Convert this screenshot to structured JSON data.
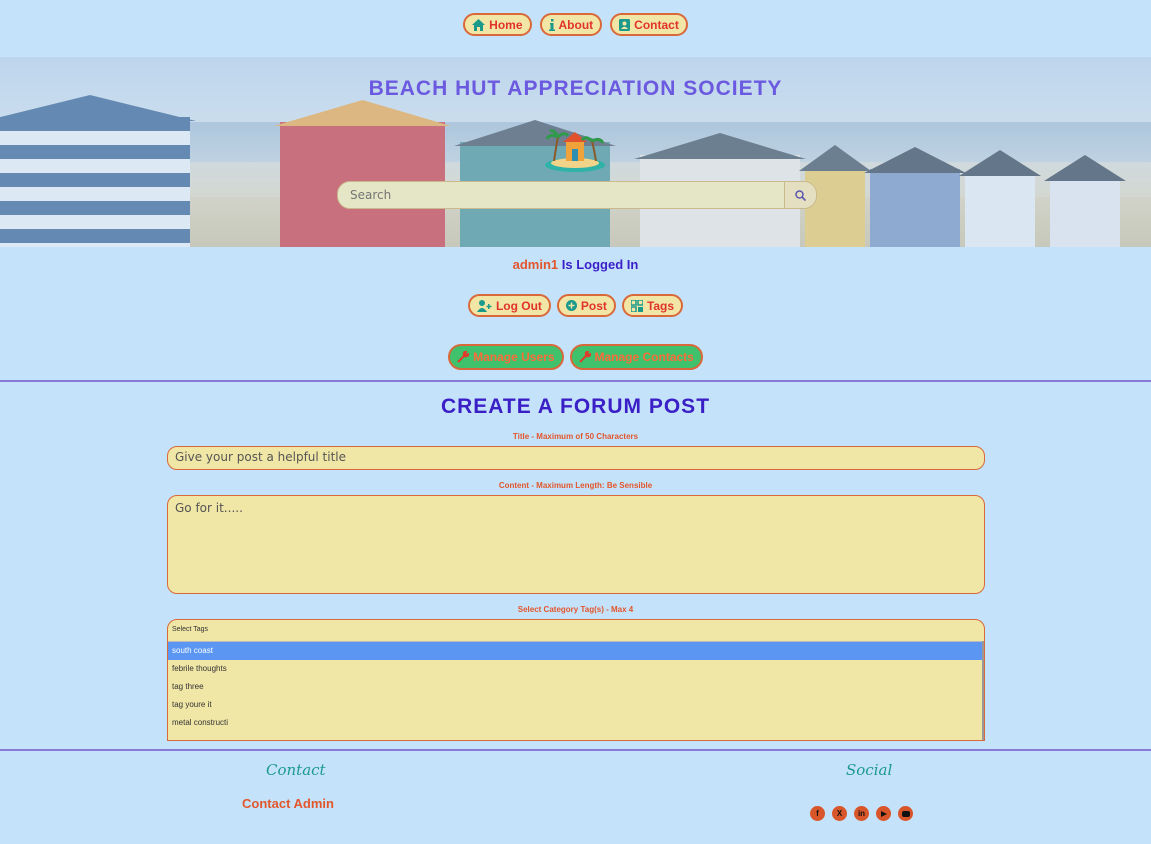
{
  "nav": {
    "home": "Home",
    "about": "About",
    "contact": "Contact"
  },
  "hero": {
    "title": "BEACH HUT APPRECIATION SOCIETY",
    "search_placeholder": "Search"
  },
  "session": {
    "username": "admin1",
    "status": "Is Logged In"
  },
  "actions": {
    "logout": "Log Out",
    "post": "Post",
    "tags": "Tags",
    "manage_users": "Manage Users",
    "manage_contacts": "Manage Contacts"
  },
  "form": {
    "heading": "CREATE A FORUM POST",
    "title_label": "Title - Maximum of 50 Characters",
    "title_placeholder": "Give your post a helpful title",
    "content_label": "Content - Maximum Length: Be Sensible",
    "content_placeholder": "Go for it.....",
    "tags_label": "Select Category Tag(s) - Max 4",
    "tags_placeholder": "Select Tags",
    "tag_options": [
      "south coast",
      "febrile thoughts",
      "tag three",
      "tag youre it",
      "metal constructi"
    ],
    "selected_tag": "south coast"
  },
  "footer": {
    "contact_heading": "Contact",
    "contact_link": "Contact Admin",
    "social_heading": "Social",
    "social_icons": [
      "facebook-icon",
      "x-icon",
      "linkedin-icon",
      "youtube-icon",
      "discord-icon"
    ]
  },
  "colors": {
    "background": "#c5e2fb",
    "accent_orange": "#e2562b",
    "accent_purple": "#3a1fc7",
    "pill_bg": "#f2e6a6",
    "manage_bg": "#3fc26b",
    "selected_option": "#5a96f2"
  }
}
